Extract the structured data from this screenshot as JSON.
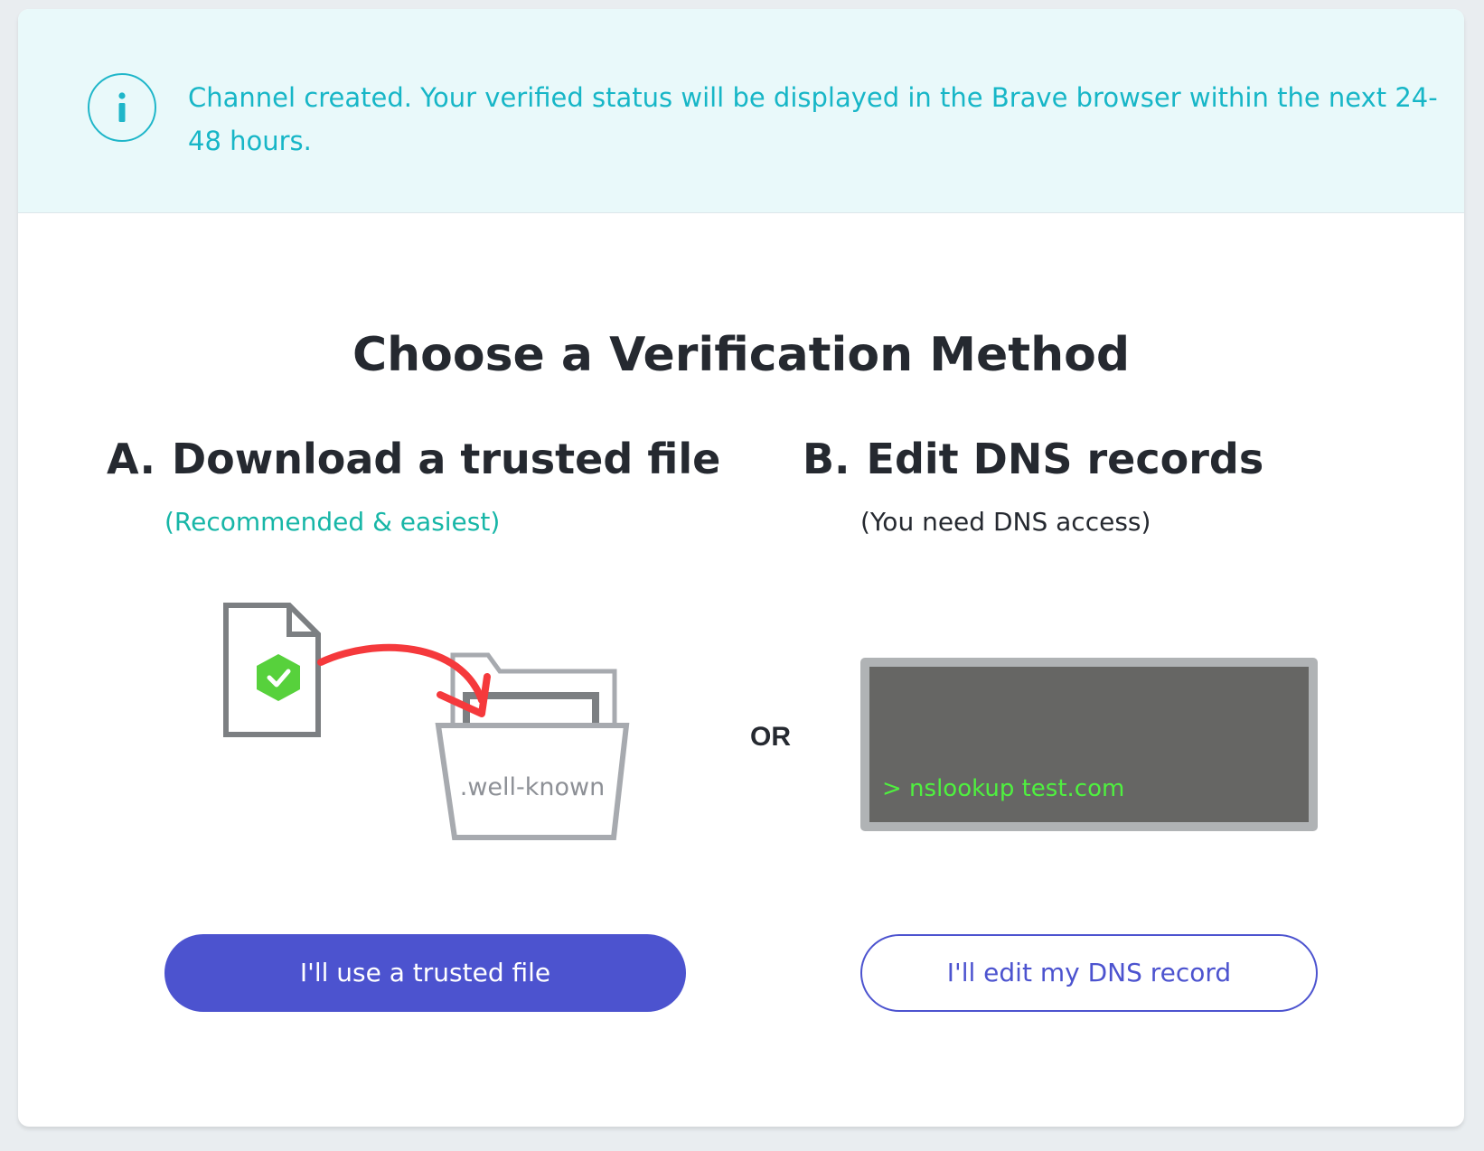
{
  "banner": {
    "icon": "info-icon",
    "message": "Channel created. Your verified status will be displayed in the Brave browser within the next 24-48 hours."
  },
  "title": "Choose a Verification Method",
  "options": [
    {
      "letter": "A.",
      "heading": "Download a trusted file",
      "subtext": "(Recommended & easiest)",
      "folder_label": ".well-known",
      "button_label": "I'll use a trusted file"
    },
    {
      "letter": "B.",
      "heading": "Edit DNS records",
      "subtext": "(You need DNS access)",
      "terminal_command": "> nslookup test.com",
      "button_label": "I'll edit my DNS record"
    }
  ],
  "separator": "OR",
  "colors": {
    "accent": "#4c53cf",
    "banner_text": "#17b6c7",
    "recommended": "#17b6a7",
    "terminal_text": "#4ff03f",
    "arrow": "#f5393c",
    "check_badge": "#57d13c"
  }
}
